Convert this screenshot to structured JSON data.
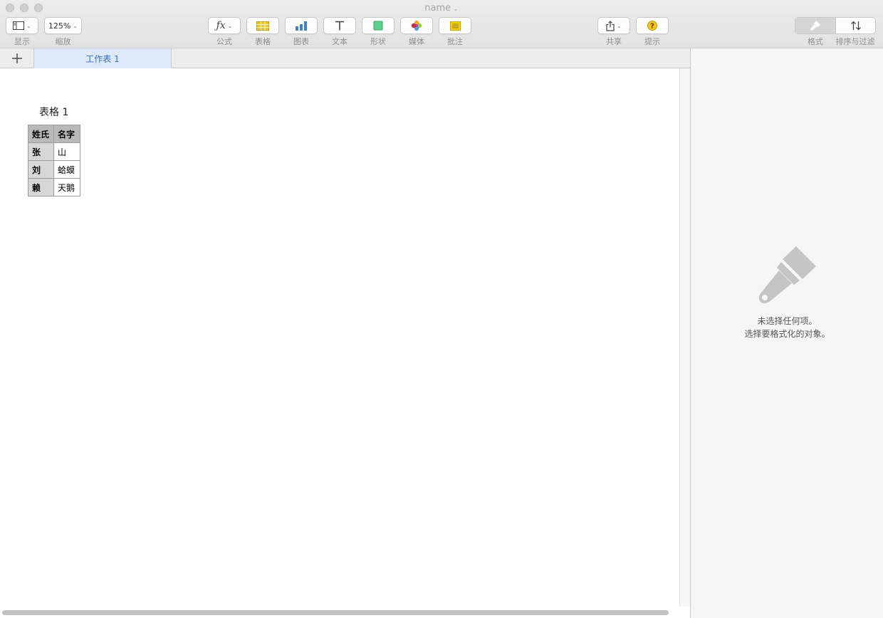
{
  "window": {
    "title": "name"
  },
  "toolbar": {
    "view": {
      "label": "显示"
    },
    "zoom": {
      "value": "125%",
      "label": "缩放"
    },
    "formula": {
      "label": "公式"
    },
    "table": {
      "label": "表格"
    },
    "chart": {
      "label": "图表"
    },
    "text": {
      "label": "文本"
    },
    "shape": {
      "label": "形状"
    },
    "media": {
      "label": "媒体"
    },
    "comment": {
      "label": "批注"
    },
    "share": {
      "label": "共享"
    },
    "tips": {
      "label": "提示"
    },
    "format": {
      "label": "格式"
    },
    "sort_filter": {
      "label": "排序与过滤"
    }
  },
  "sheets": {
    "tabs": [
      {
        "label": "工作表 1",
        "active": true
      }
    ]
  },
  "table": {
    "title": "表格 1",
    "headers": [
      "姓氏",
      "名字"
    ],
    "rows": [
      [
        "张",
        "山"
      ],
      [
        "刘",
        "蛤蟆"
      ],
      [
        "赖",
        "天鹅"
      ]
    ]
  },
  "inspector": {
    "line1": "未选择任何项。",
    "line2": "选择要格式化的对象。"
  },
  "colors": {
    "accent_tab": "#dbe9fb",
    "accent_tab_text": "#3f6fae",
    "table_icon": "#f5c518",
    "chart_icon": "#3b82d6",
    "shape_icon": "#5ccf8e",
    "comment_icon": "#f5d000",
    "tips_icon": "#f5c518"
  },
  "icons": {
    "view": "sidebar-icon",
    "formula": "fx-icon",
    "table": "table-grid-icon",
    "chart": "bar-chart-icon",
    "text": "text-t-icon",
    "shape": "square-shape-icon",
    "media": "photos-flower-icon",
    "comment": "note-icon",
    "share": "share-arrow-icon",
    "tips": "question-icon",
    "format": "paintbrush-icon",
    "sort": "sort-arrows-icon",
    "add_sheet": "plus-icon",
    "inspector_empty": "paintbrush-icon"
  }
}
